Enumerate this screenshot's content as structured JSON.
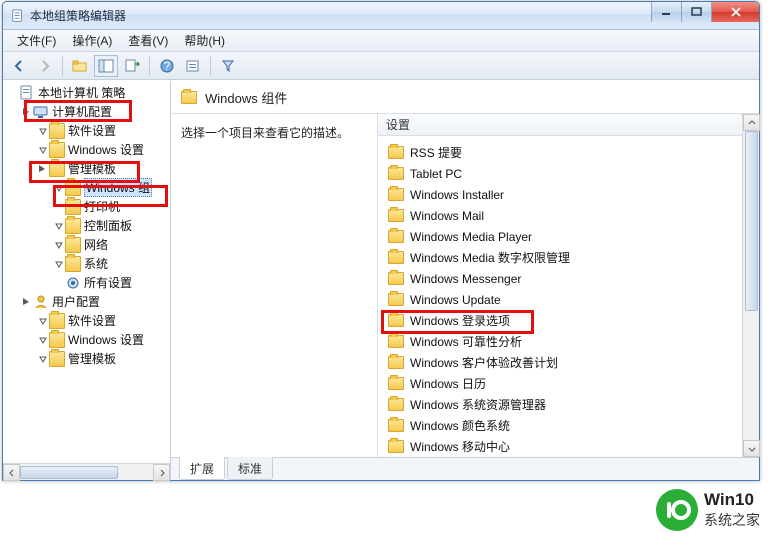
{
  "window": {
    "title": "本地组策略编辑器"
  },
  "menus": {
    "file": "文件(F)",
    "action": "操作(A)",
    "view": "查看(V)",
    "help": "帮助(H)"
  },
  "tree": {
    "root": "本地计算机 策略",
    "computer_cfg": "计算机配置",
    "software_settings": "软件设置",
    "windows_settings": "Windows 设置",
    "admin_templates": "管理模板",
    "windows_components": "Windows 组",
    "printers": "打印机",
    "control_panel": "控制面板",
    "network": "网络",
    "system": "系统",
    "all_settings": "所有设置",
    "user_cfg": "用户配置",
    "u_software_settings": "软件设置",
    "u_windows_settings": "Windows 设置",
    "u_admin_templates": "管理模板"
  },
  "right": {
    "header": "Windows 组件",
    "desc_prompt": "选择一个项目来查看它的描述。",
    "setting_header": "设置",
    "items": [
      "RSS 提要",
      "Tablet PC",
      "Windows Installer",
      "Windows Mail",
      "Windows Media Player",
      "Windows Media 数字权限管理",
      "Windows Messenger",
      "Windows Update",
      "Windows 登录选项",
      "Windows 可靠性分析",
      "Windows 客户体验改善计划",
      "Windows 日历",
      "Windows 系统资源管理器",
      "Windows 颜色系统",
      "Windows 移动中心"
    ]
  },
  "tabs": {
    "extended": "扩展",
    "standard": "标准"
  },
  "watermark": {
    "line1": "Win10",
    "line2": "系统之家"
  }
}
